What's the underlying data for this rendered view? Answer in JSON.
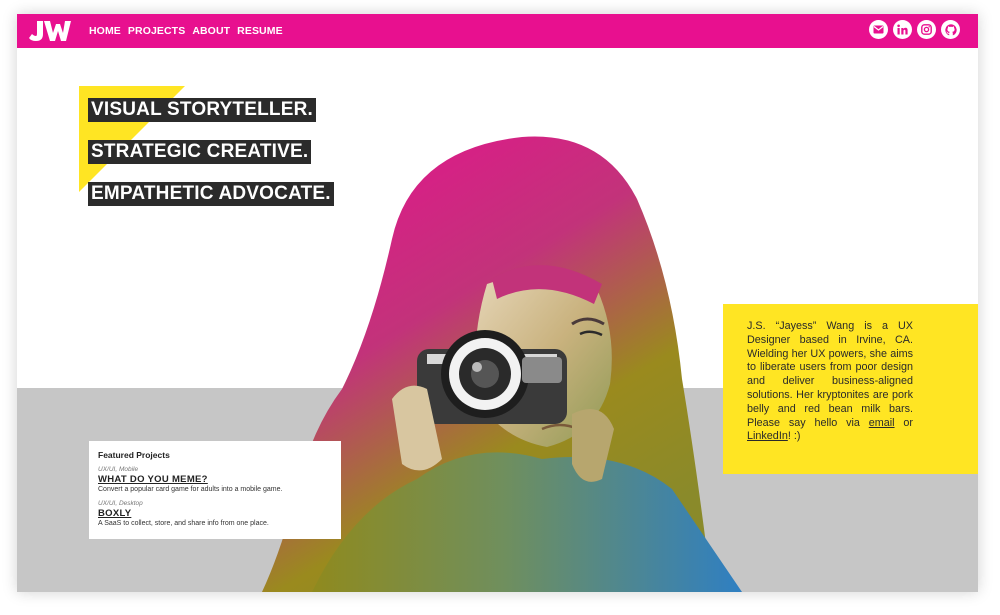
{
  "nav": {
    "logo_text": "JW",
    "links": [
      "HOME",
      "PROJECTS",
      "ABOUT",
      "RESUME"
    ],
    "social_icons": [
      "mail-icon",
      "linkedin-icon",
      "instagram-icon",
      "github-icon"
    ]
  },
  "hero": {
    "taglines": [
      "VISUAL STORYTELLER.",
      "STRATEGIC CREATIVE.",
      "EMPATHETIC ADVOCATE."
    ]
  },
  "about": {
    "text_before_email": "J.S. “Jayess” Wang is a UX Designer based in Irvine, CA. Wielding her UX powers, she aims to liberate users from poor design and deliver business-aligned solutions. Her kryptonites are pork belly and red bean milk bars. Please say hello via ",
    "email_link": "email",
    "text_between": " or ",
    "linkedin_link": "LinkedIn",
    "text_after": "! :)"
  },
  "featured": {
    "title": "Featured Projects",
    "projects": [
      {
        "category": "UX/UI, Mobile",
        "name": "WHAT DO YOU MEME?",
        "description": "Convert a popular card game for adults into a mobile game."
      },
      {
        "category": "UX/UI, Desktop",
        "name": "BOXLY",
        "description": "A SaaS to collect, store, and share info from one place."
      }
    ]
  },
  "colors": {
    "brand_pink": "#e8108f",
    "accent_yellow": "#ffe523",
    "tag_background": "#2b2b2b",
    "band_gray": "#c6c6c6"
  }
}
